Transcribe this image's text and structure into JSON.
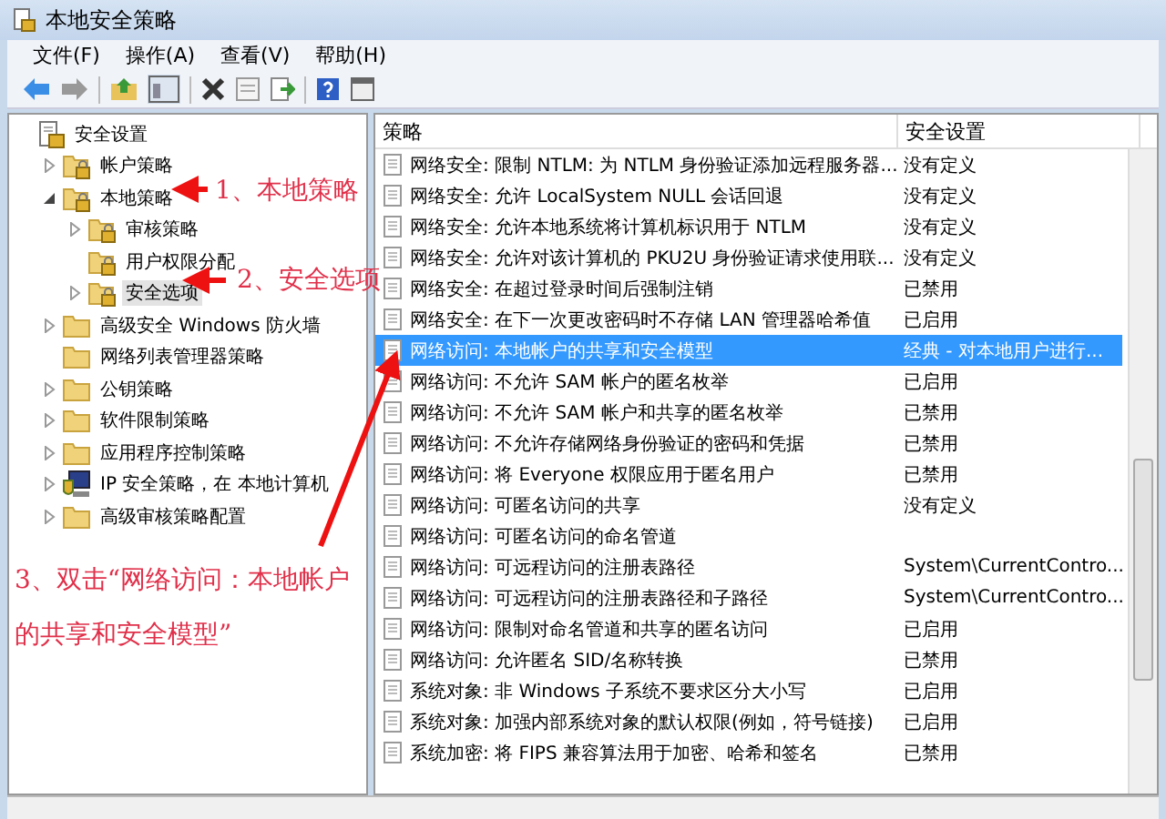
{
  "window": {
    "title": "本地安全策略"
  },
  "menu": [
    "文件(F)",
    "操作(A)",
    "查看(V)",
    "帮助(H)"
  ],
  "tree": [
    {
      "label": "安全设置",
      "kind": "root",
      "selected": false,
      "children": [
        {
          "label": "帐户策略",
          "kind": "locked-folder",
          "expandable": true,
          "expanded": false,
          "selected": false
        },
        {
          "label": "本地策略",
          "kind": "locked-folder",
          "expandable": true,
          "expanded": true,
          "selected": false,
          "children": [
            {
              "label": "审核策略",
              "kind": "locked-folder",
              "expandable": true,
              "expanded": false,
              "selected": false
            },
            {
              "label": "用户权限分配",
              "kind": "locked-folder",
              "expandable": false,
              "expanded": false,
              "selected": false
            },
            {
              "label": "安全选项",
              "kind": "locked-folder",
              "expandable": true,
              "expanded": false,
              "selected": true
            }
          ]
        },
        {
          "label": "高级安全 Windows 防火墙",
          "kind": "folder",
          "expandable": true,
          "expanded": false,
          "selected": false
        },
        {
          "label": "网络列表管理器策略",
          "kind": "folder",
          "expandable": false,
          "expanded": false,
          "selected": false
        },
        {
          "label": "公钥策略",
          "kind": "folder",
          "expandable": true,
          "expanded": false,
          "selected": false
        },
        {
          "label": "软件限制策略",
          "kind": "folder",
          "expandable": true,
          "expanded": false,
          "selected": false
        },
        {
          "label": "应用程序控制策略",
          "kind": "folder",
          "expandable": true,
          "expanded": false,
          "selected": false
        },
        {
          "label": "IP 安全策略，在 本地计算机",
          "kind": "ip",
          "expandable": true,
          "expanded": false,
          "selected": false
        },
        {
          "label": "高级审核策略配置",
          "kind": "folder",
          "expandable": true,
          "expanded": false,
          "selected": false
        }
      ]
    }
  ],
  "table": {
    "columns": [
      "策略",
      "安全设置"
    ],
    "rows": [
      {
        "policy": "网络安全: 限制 NTLM: 为 NTLM 身份验证添加远程服务器...",
        "setting": "没有定义",
        "selected": false
      },
      {
        "policy": "网络安全: 允许 LocalSystem NULL 会话回退",
        "setting": "没有定义",
        "selected": false
      },
      {
        "policy": "网络安全: 允许本地系统将计算机标识用于 NTLM",
        "setting": "没有定义",
        "selected": false
      },
      {
        "policy": "网络安全: 允许对该计算机的 PKU2U 身份验证请求使用联...",
        "setting": "没有定义",
        "selected": false
      },
      {
        "policy": "网络安全: 在超过登录时间后强制注销",
        "setting": "已禁用",
        "selected": false
      },
      {
        "policy": "网络安全: 在下一次更改密码时不存储 LAN 管理器哈希值",
        "setting": "已启用",
        "selected": false
      },
      {
        "policy": "网络访问: 本地帐户的共享和安全模型",
        "setting": "经典 - 对本地用户进行...",
        "selected": true
      },
      {
        "policy": "网络访问: 不允许 SAM 帐户的匿名枚举",
        "setting": "已启用",
        "selected": false
      },
      {
        "policy": "网络访问: 不允许 SAM 帐户和共享的匿名枚举",
        "setting": "已禁用",
        "selected": false
      },
      {
        "policy": "网络访问: 不允许存储网络身份验证的密码和凭据",
        "setting": "已禁用",
        "selected": false
      },
      {
        "policy": "网络访问: 将 Everyone 权限应用于匿名用户",
        "setting": "已禁用",
        "selected": false
      },
      {
        "policy": "网络访问: 可匿名访问的共享",
        "setting": "没有定义",
        "selected": false
      },
      {
        "policy": "网络访问: 可匿名访问的命名管道",
        "selected": false
      },
      {
        "policy": "网络访问: 可远程访问的注册表路径",
        "setting": "System\\CurrentContro...",
        "selected": false
      },
      {
        "policy": "网络访问: 可远程访问的注册表路径和子路径",
        "setting": "System\\CurrentContro...",
        "selected": false
      },
      {
        "policy": "网络访问: 限制对命名管道和共享的匿名访问",
        "setting": "已启用",
        "selected": false
      },
      {
        "policy": "网络访问: 允许匿名 SID/名称转换",
        "setting": "已禁用",
        "selected": false
      },
      {
        "policy": "系统对象: 非 Windows 子系统不要求区分大小写",
        "setting": "已启用",
        "selected": false
      },
      {
        "policy": "系统对象: 加强内部系统对象的默认权限(例如，符号链接)",
        "setting": "已启用",
        "selected": false
      },
      {
        "policy": "系统加密: 将 FIPS 兼容算法用于加密、哈希和签名",
        "setting": "已禁用",
        "selected": false
      }
    ]
  },
  "annotations": [
    "1、本地策略",
    "2、安全选项",
    "3、双击“网络访问：本地帐户的共享和安全模型”"
  ]
}
